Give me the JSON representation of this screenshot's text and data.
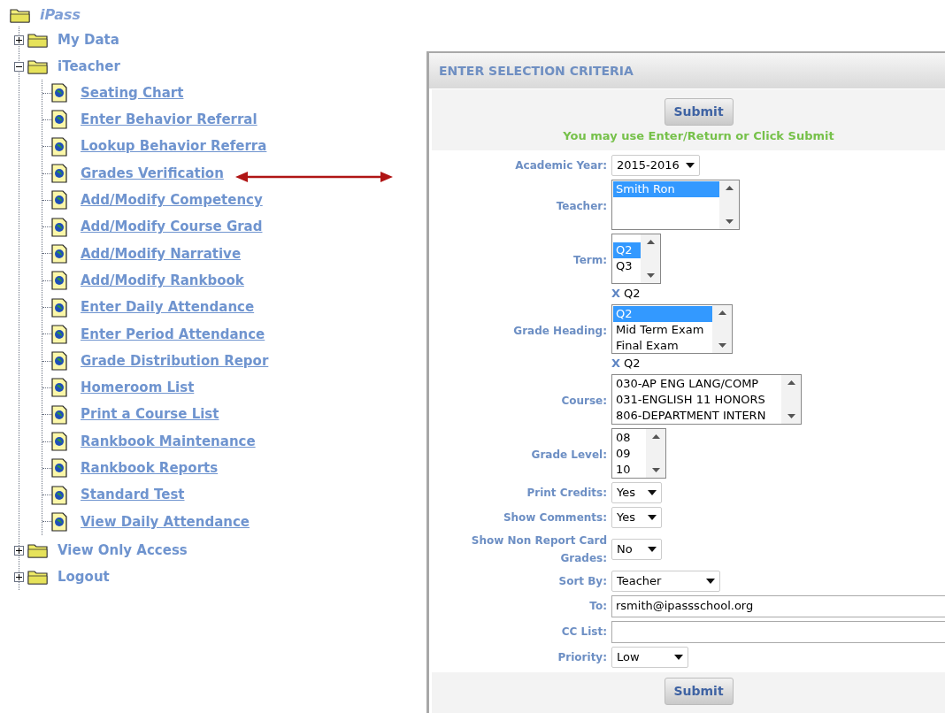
{
  "tree": {
    "label": "iPass",
    "children": [
      {
        "label": "My Data",
        "expanded": false
      },
      {
        "label": "iTeacher",
        "expanded": true,
        "children": [
          {
            "label": "Seating Chart"
          },
          {
            "label": "Enter Behavior Referral"
          },
          {
            "label": "Lookup Behavior Referra"
          },
          {
            "label": "Grades Verification"
          },
          {
            "label": "Add/Modify Competency"
          },
          {
            "label": "Add/Modify Course Grad"
          },
          {
            "label": "Add/Modify Narrative"
          },
          {
            "label": "Add/Modify Rankbook"
          },
          {
            "label": "Enter Daily Attendance"
          },
          {
            "label": "Enter Period Attendance"
          },
          {
            "label": "Grade Distribution Repor"
          },
          {
            "label": "Homeroom List"
          },
          {
            "label": "Print a Course List"
          },
          {
            "label": "Rankbook Maintenance"
          },
          {
            "label": "Rankbook Reports"
          },
          {
            "label": "Standard Test"
          },
          {
            "label": "View Daily Attendance"
          }
        ]
      },
      {
        "label": "View Only Access",
        "expanded": false
      },
      {
        "label": "Logout",
        "expanded": false
      }
    ]
  },
  "panel": {
    "title": "ENTER SELECTION CRITERIA",
    "submit": "Submit",
    "submit_bottom": "Submit",
    "hint": "You may use Enter/Return or Click Submit",
    "fields": [
      {
        "kind": "select",
        "label": "Academic Year:",
        "value": "2015-2016"
      },
      {
        "kind": "listbox",
        "label": "Teacher:",
        "options": [
          {
            "text": "Smith Ron",
            "selected": true
          }
        ]
      },
      {
        "kind": "listbox",
        "label": "Term:",
        "options": [
          {
            "text": "Q2",
            "selected": true
          },
          {
            "text": "Q3",
            "selected": false
          }
        ],
        "chips": [
          {
            "remove": "X",
            "text": "Q2"
          }
        ]
      },
      {
        "kind": "listbox",
        "label": "Grade Heading:",
        "options": [
          {
            "text": "Q2",
            "selected": true
          },
          {
            "text": "Mid Term Exam",
            "selected": false
          },
          {
            "text": "Final Exam",
            "selected": false
          }
        ],
        "chips": [
          {
            "remove": "X",
            "text": "Q2"
          }
        ]
      },
      {
        "kind": "listbox",
        "label": "Course:",
        "options": [
          {
            "text": "030-AP ENG LANG/COMP",
            "selected": false
          },
          {
            "text": "031-ENGLISH 11 HONORS",
            "selected": false
          },
          {
            "text": "806-DEPARTMENT INTERN",
            "selected": false
          }
        ]
      },
      {
        "kind": "listbox",
        "label": "Grade Level:",
        "options": [
          {
            "text": "08",
            "selected": false
          },
          {
            "text": "09",
            "selected": false
          },
          {
            "text": "10",
            "selected": false
          }
        ]
      },
      {
        "kind": "select",
        "label": "Print Credits:",
        "value": "Yes"
      },
      {
        "kind": "select",
        "label": "Show Comments:",
        "value": "Yes"
      },
      {
        "kind": "select",
        "label": "Show Non Report Card Grades:",
        "value": "No"
      },
      {
        "kind": "select",
        "label": "Sort By:",
        "value": "Teacher"
      },
      {
        "kind": "text",
        "label": "To:",
        "value": "rsmith@ipassschool.org"
      },
      {
        "kind": "text",
        "label": "CC List:"
      },
      {
        "kind": "select",
        "label": "Priority:",
        "value": "Low"
      }
    ]
  }
}
